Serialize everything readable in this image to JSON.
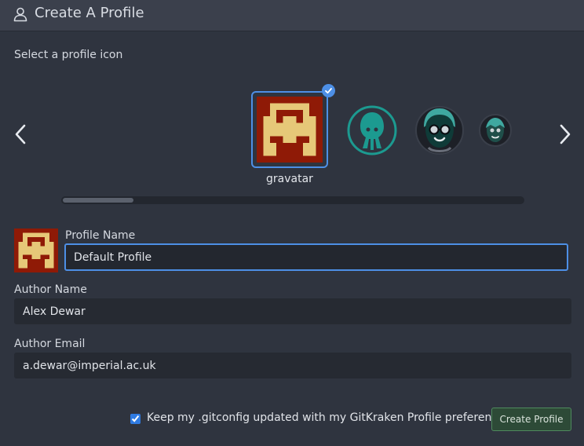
{
  "header": {
    "title": "Create A Profile",
    "icon": "user-icon"
  },
  "icon_picker": {
    "label": "Select a profile icon",
    "selected_label": "gravatar",
    "icons": [
      "gravatar",
      "gitkraken-squid",
      "keif-with-glasses",
      "keif-small"
    ]
  },
  "form": {
    "profile_name_label": "Profile Name",
    "profile_name_value": "Default Profile",
    "author_name_label": "Author Name",
    "author_name_value": "Alex Dewar",
    "author_email_label": "Author Email",
    "author_email_value": "a.dewar@imperial.ac.uk"
  },
  "footer": {
    "checkbox_label": "Keep my .gitconfig updated with my GitKraken Profile preferences",
    "checkbox_checked": true,
    "create_button": "Create Profile"
  },
  "colors": {
    "background": "#2f343f",
    "accent": "#4d8fe6",
    "gravatar_bg": "#8f1a06",
    "gravatar_fg": "#e6c878",
    "teal": "#1c9a90"
  }
}
